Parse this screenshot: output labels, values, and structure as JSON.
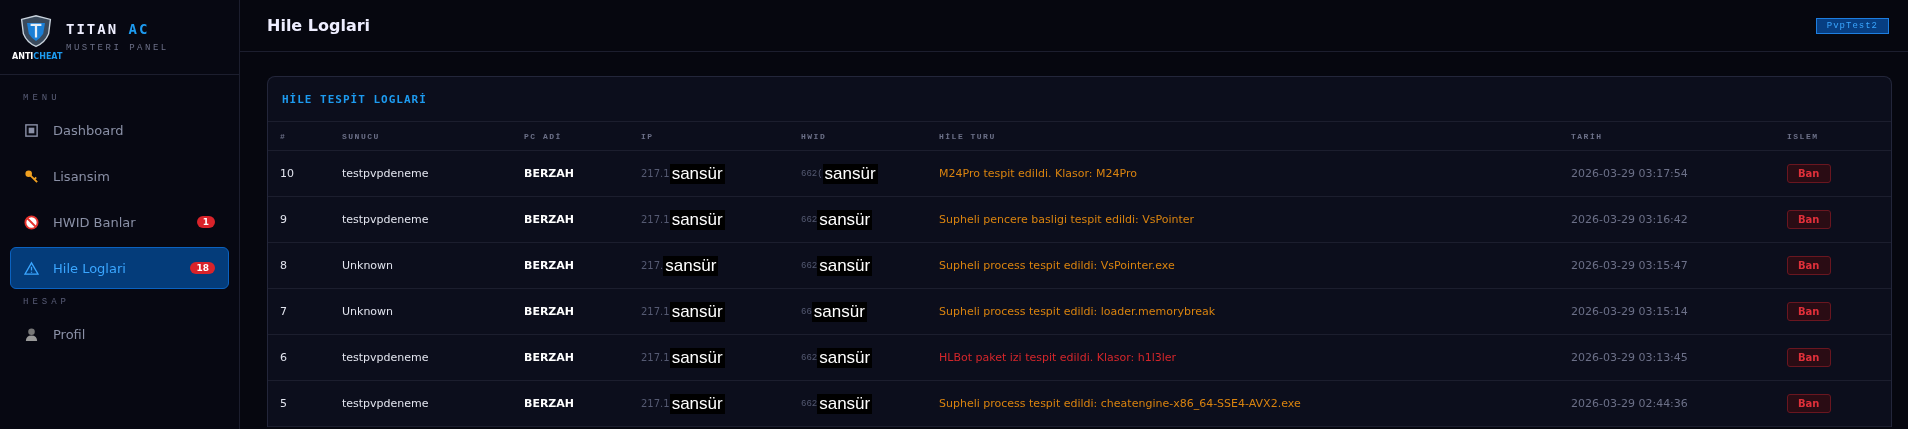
{
  "brand": {
    "name": "TITAN",
    "accent": "AC",
    "subtitle": "MUSTERI PANEL",
    "logo_text_a": "ANTI",
    "logo_text_b": "CHEAT"
  },
  "sidebar": {
    "sections": [
      {
        "label": "MENU",
        "items": [
          {
            "label": "Dashboard",
            "kind": "dashboard",
            "selected": false
          },
          {
            "label": "Lisansim",
            "kind": "key",
            "selected": false
          },
          {
            "label": "HWID Banlar",
            "kind": "ban",
            "selected": false,
            "badge": "1"
          },
          {
            "label": "Hile Loglari",
            "kind": "warning",
            "selected": true,
            "badge": "18"
          }
        ]
      },
      {
        "label": "HESAP",
        "items": [
          {
            "label": "Profil",
            "kind": "user",
            "selected": false
          }
        ]
      }
    ]
  },
  "header": {
    "title": "Hile Loglari",
    "user_tag": "PvpTest2"
  },
  "card": {
    "title": "HİLE TESPİT LOGLARİ",
    "columns": [
      "#",
      "SUNUCU",
      "PC ADİ",
      "IP",
      "HWID",
      "HİLE TURU",
      "TARİH",
      "ISLEM"
    ],
    "rows": [
      {
        "id": "10",
        "server": "testpvpdeneme",
        "pc": "BERZAH",
        "ip": "217.1",
        "ip_censor": "sansür",
        "hwid": "662(",
        "hwid_censor": "sansür",
        "cheat": "M24Pro tespit edildi. Klasor: M24Pro",
        "color": "#d9830f",
        "date": "2026-03-29 03:17:54",
        "action": "Ban"
      },
      {
        "id": "9",
        "server": "testpvpdeneme",
        "pc": "BERZAH",
        "ip": "217.1",
        "ip_censor": "sansür",
        "hwid": "662",
        "hwid_censor": "sansür",
        "cheat": "Supheli pencere basligi tespit edildi: VsPointer",
        "color": "#d9830f",
        "date": "2026-03-29 03:16:42",
        "action": "Ban"
      },
      {
        "id": "8",
        "server": "Unknown",
        "pc": "BERZAH",
        "ip": "217.",
        "ip_censor": "sansür",
        "hwid": "662",
        "hwid_censor": "sansür",
        "cheat": "Supheli process tespit edildi: VsPointer.exe",
        "color": "#d9830f",
        "date": "2026-03-29 03:15:47",
        "action": "Ban"
      },
      {
        "id": "7",
        "server": "Unknown",
        "pc": "BERZAH",
        "ip": "217.1",
        "ip_censor": "sansür",
        "hwid": "66",
        "hwid_censor": "sansür",
        "cheat": "Supheli process tespit edildi: loader.memorybreak",
        "color": "#d9830f",
        "date": "2026-03-29 03:15:14",
        "action": "Ban"
      },
      {
        "id": "6",
        "server": "testpvpdeneme",
        "pc": "BERZAH",
        "ip": "217.1",
        "ip_censor": "sansür",
        "hwid": "662",
        "hwid_censor": "sansür",
        "cheat": "HLBot paket izi tespit edildi. Klasor: h1l3ler",
        "color": "#d4262b",
        "date": "2026-03-29 03:13:45",
        "action": "Ban"
      },
      {
        "id": "5",
        "server": "testpvpdeneme",
        "pc": "BERZAH",
        "ip": "217.1",
        "ip_censor": "sansür",
        "hwid": "662",
        "hwid_censor": "sansür",
        "cheat": "Supheli process tespit edildi: cheatengine-x86_64-SSE4-AVX2.exe",
        "color": "#d9830f",
        "date": "2026-03-29 02:44:36",
        "action": "Ban"
      }
    ]
  }
}
